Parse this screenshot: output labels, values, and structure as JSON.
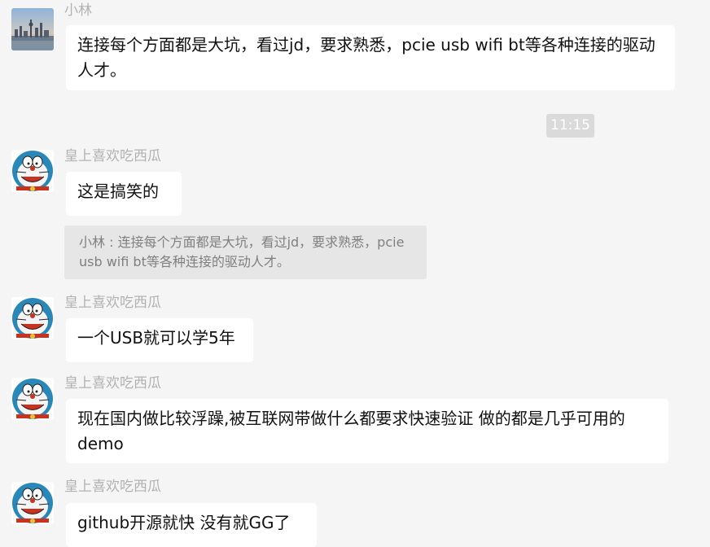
{
  "messages": [
    {
      "sender": "小林",
      "text": "连接每个方面都是大坑，看过jd，要求熟悉，pcie usb wifi bt等各种连接的驱动人才。"
    },
    {
      "sender": "皇上喜欢吃西瓜",
      "text": "这是搞笑的"
    },
    {
      "sender": "皇上喜欢吃西瓜",
      "text": "一个USB就可以学5年"
    },
    {
      "sender": "皇上喜欢吃西瓜",
      "text": " 现在国内做比较浮躁,被互联网带做什么都要求快速验证 做的都是几乎可用的demo"
    },
    {
      "sender": "皇上喜欢吃西瓜",
      "text": "github开源就快 没有就GG了"
    }
  ],
  "timestamp": "11:15",
  "quote": {
    "text": "小林 : 连接每个方面都是大坑，看过jd，要求熟悉，pcie usb wifi bt等各种连接的驱动人才。"
  },
  "avatars": {
    "xiaolin": "city-skyline-avatar",
    "huangshang": "doraemon-avatar"
  }
}
